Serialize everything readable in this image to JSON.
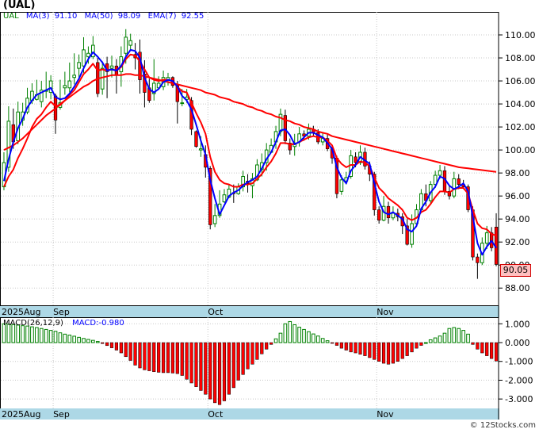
{
  "title": "(UAL)",
  "legend": {
    "ticker": "UAL",
    "ma3_label": "MA(3)",
    "ma3_value": "91.10",
    "ma50_label": "MA(50)",
    "ma50_value": "98.09",
    "ema7_label": "EMA(7)",
    "ema7_value": "92.55"
  },
  "macd_legend": {
    "label": "MACD(26,12,9)",
    "value_label": "MACD:-0.980"
  },
  "watermark": "© 12Stocks.com",
  "last_price_label": "90.05",
  "colors": {
    "up": "#008000",
    "down": "#ff0000",
    "ma_blue": "#0000ff",
    "ema_red": "#ff0000",
    "axis_band": "#add8e6"
  },
  "chart_data": [
    {
      "type": "candlestick",
      "ylim": [
        86.5,
        112
      ],
      "y_ticks": [
        "88.00",
        "90.00",
        "92.00",
        "94.00",
        "96.00",
        "98.00",
        "100.00",
        "102.00",
        "104.00",
        "106.00",
        "108.00",
        "110.00"
      ],
      "x_labels": [
        {
          "text": "2025Aug",
          "index": 0
        },
        {
          "text": "Sep",
          "index": 11
        },
        {
          "text": "Oct",
          "index": 44
        },
        {
          "text": "Nov",
          "index": 80
        }
      ],
      "candles": [
        [
          96.8,
          98.9,
          96.5,
          99.8
        ],
        [
          98.5,
          102.5,
          98.1,
          103.8
        ],
        [
          102.2,
          100.7,
          100.1,
          103.6
        ],
        [
          100.8,
          103.3,
          100.5,
          104.2
        ],
        [
          102.6,
          103.3,
          102.1,
          104.1
        ],
        [
          103.3,
          104.5,
          103.1,
          105.4
        ],
        [
          104.3,
          105.1,
          104.0,
          105.8
        ],
        [
          104.4,
          104.8,
          104.3,
          106.1
        ],
        [
          104.2,
          105.2,
          103.7,
          106.0
        ],
        [
          105.1,
          105.2,
          104.5,
          106.8
        ],
        [
          105.0,
          106.0,
          104.4,
          106.5
        ],
        [
          104.7,
          102.6,
          101.4,
          104.9
        ],
        [
          103.7,
          104.1,
          103.5,
          106.1
        ],
        [
          105.4,
          105.6,
          104.8,
          106.8
        ],
        [
          105.4,
          106.0,
          105.0,
          107.6
        ],
        [
          106.3,
          106.5,
          105.7,
          108.4
        ],
        [
          107.1,
          107.6,
          106.3,
          108.3
        ],
        [
          107.3,
          108.7,
          106.7,
          109.8
        ],
        [
          108.1,
          108.4,
          107.5,
          109.0
        ],
        [
          108.1,
          109.1,
          107.9,
          109.9
        ],
        [
          107.6,
          104.9,
          104.6,
          108.0
        ],
        [
          105.3,
          107.1,
          104.8,
          107.7
        ],
        [
          107.5,
          106.8,
          104.5,
          108.1
        ],
        [
          107.1,
          107.3,
          106.3,
          108.2
        ],
        [
          107.3,
          106.5,
          104.9,
          107.9
        ],
        [
          106.8,
          108.1,
          105.5,
          109.0
        ],
        [
          108.4,
          109.8,
          107.5,
          110.5
        ],
        [
          109.1,
          109.5,
          108.6,
          110.1
        ],
        [
          108.3,
          108.0,
          107.0,
          109.3
        ],
        [
          108.5,
          106.1,
          104.9,
          109.6
        ],
        [
          106.6,
          105.0,
          103.7,
          107.8
        ],
        [
          105.4,
          104.3,
          104.1,
          106.2
        ],
        [
          104.9,
          105.8,
          104.3,
          107.9
        ],
        [
          105.4,
          105.8,
          105.3,
          106.4
        ],
        [
          105.5,
          106.3,
          105.2,
          106.9
        ],
        [
          106.1,
          106.3,
          105.6,
          106.7
        ],
        [
          106.3,
          105.6,
          105.4,
          106.4
        ],
        [
          105.6,
          104.2,
          102.3,
          106.0
        ],
        [
          104.1,
          104.1,
          103.8,
          105.3
        ],
        [
          104.4,
          104.6,
          104.1,
          105.3
        ],
        [
          104.3,
          101.8,
          101.3,
          104.6
        ],
        [
          101.6,
          100.3,
          100.2,
          101.7
        ],
        [
          100.0,
          100.1,
          99.4,
          101.2
        ],
        [
          99.6,
          98.5,
          97.6,
          100.4
        ],
        [
          98.4,
          93.5,
          93.1,
          98.6
        ],
        [
          93.6,
          94.3,
          93.3,
          95.3
        ],
        [
          94.3,
          95.3,
          94.1,
          96.5
        ],
        [
          95.5,
          96.1,
          95.4,
          96.6
        ],
        [
          95.9,
          96.6,
          95.8,
          97.0
        ],
        [
          96.3,
          96.2,
          95.4,
          97.0
        ],
        [
          96.2,
          96.8,
          96.1,
          97.1
        ],
        [
          96.8,
          97.7,
          96.4,
          98.2
        ],
        [
          97.3,
          97.1,
          96.3,
          97.9
        ],
        [
          96.9,
          97.5,
          95.8,
          98.0
        ],
        [
          97.4,
          98.7,
          97.3,
          99.2
        ],
        [
          98.3,
          98.9,
          97.7,
          99.7
        ],
        [
          98.9,
          100.0,
          98.2,
          100.6
        ],
        [
          99.8,
          100.4,
          99.8,
          101.0
        ],
        [
          100.7,
          101.6,
          100.1,
          102.1
        ],
        [
          101.6,
          103.1,
          101.2,
          103.6
        ],
        [
          103.0,
          100.8,
          100.5,
          103.5
        ],
        [
          100.6,
          100.0,
          99.6,
          101.0
        ],
        [
          100.3,
          100.6,
          99.5,
          101.4
        ],
        [
          100.7,
          101.4,
          100.3,
          102.0
        ],
        [
          101.4,
          101.2,
          100.8,
          101.7
        ],
        [
          101.2,
          101.8,
          100.9,
          102.3
        ],
        [
          101.8,
          101.5,
          101.2,
          102.1
        ],
        [
          101.5,
          100.7,
          100.5,
          101.8
        ],
        [
          100.7,
          101.0,
          100.4,
          101.5
        ],
        [
          101.0,
          100.1,
          99.9,
          101.4
        ],
        [
          100.1,
          99.3,
          98.8,
          100.3
        ],
        [
          99.3,
          96.2,
          95.8,
          99.5
        ],
        [
          96.4,
          97.4,
          96.1,
          97.8
        ],
        [
          97.3,
          97.6,
          97.0,
          98.1
        ],
        [
          97.7,
          99.5,
          97.5,
          100.0
        ],
        [
          99.4,
          98.9,
          98.5,
          99.8
        ],
        [
          98.9,
          99.8,
          98.7,
          100.4
        ],
        [
          99.8,
          98.6,
          98.3,
          100.2
        ],
        [
          98.6,
          97.9,
          97.3,
          99.0
        ],
        [
          97.9,
          94.8,
          94.3,
          98.1
        ],
        [
          94.8,
          93.9,
          93.6,
          95.1
        ],
        [
          93.9,
          95.1,
          93.8,
          96.0
        ],
        [
          95.1,
          94.1,
          93.6,
          95.5
        ],
        [
          94.1,
          94.5,
          93.9,
          95.1
        ],
        [
          94.5,
          94.2,
          93.8,
          94.9
        ],
        [
          94.2,
          93.4,
          92.7,
          94.5
        ],
        [
          93.4,
          91.8,
          91.7,
          94.0
        ],
        [
          91.8,
          93.6,
          91.5,
          94.4
        ],
        [
          93.6,
          94.8,
          93.3,
          95.3
        ],
        [
          94.8,
          96.2,
          94.7,
          96.6
        ],
        [
          96.2,
          95.6,
          95.1,
          97.0
        ],
        [
          95.6,
          97.0,
          95.3,
          97.3
        ],
        [
          97.0,
          97.8,
          96.7,
          98.2
        ],
        [
          97.8,
          98.2,
          97.5,
          98.7
        ],
        [
          98.2,
          96.4,
          96.1,
          98.6
        ],
        [
          96.4,
          96.0,
          95.7,
          96.9
        ],
        [
          96.0,
          97.5,
          95.8,
          98.1
        ],
        [
          97.5,
          97.0,
          96.6,
          97.9
        ],
        [
          97.0,
          96.8,
          96.6,
          97.4
        ],
        [
          96.8,
          94.8,
          94.6,
          97.0
        ],
        [
          94.8,
          90.7,
          90.4,
          95.1
        ],
        [
          90.7,
          90.2,
          88.8,
          91.0
        ],
        [
          90.2,
          91.9,
          90.0,
          92.4
        ],
        [
          91.9,
          92.8,
          91.4,
          93.4
        ],
        [
          92.8,
          91.5,
          91.2,
          93.3
        ],
        [
          93.3,
          90.05,
          89.9,
          94.5
        ]
      ],
      "ma3": [
        97.3,
        99.2,
        100.7,
        101.9,
        102.7,
        103.7,
        104.3,
        104.8,
        105.0,
        105.2,
        105.4,
        104.6,
        104.4,
        104.5,
        104.9,
        105.5,
        106.2,
        107.1,
        107.9,
        108.5,
        108.1,
        107.6,
        106.9,
        107.0,
        106.9,
        107.3,
        108.1,
        108.7,
        108.6,
        108.0,
        106.3,
        105.3,
        105.0,
        105.3,
        105.9,
        106.1,
        106.0,
        105.5,
        104.7,
        104.3,
        103.5,
        102.2,
        100.8,
        99.6,
        97.4,
        95.8,
        94.4,
        95.2,
        96.0,
        96.3,
        96.5,
        96.9,
        97.2,
        97.4,
        97.7,
        98.4,
        99.2,
        99.8,
        100.7,
        101.7,
        101.8,
        101.3,
        100.5,
        100.7,
        101.1,
        101.5,
        101.5,
        101.3,
        101.1,
        100.6,
        100.1,
        98.5,
        97.6,
        97.1,
        98.2,
        98.7,
        99.4,
        99.1,
        98.8,
        97.1,
        95.5,
        94.6,
        94.4,
        94.6,
        94.3,
        94.0,
        93.1,
        92.9,
        93.4,
        94.9,
        95.5,
        96.3,
        96.8,
        97.7,
        97.5,
        96.9,
        96.6,
        96.8,
        97.1,
        96.4,
        94.2,
        91.9,
        90.9,
        91.6,
        92.1,
        91.5
      ],
      "ema7": [
        96.8,
        97.7,
        98.3,
        99.3,
        100.1,
        101.0,
        102.0,
        102.7,
        103.1,
        103.7,
        104.2,
        103.8,
        103.9,
        104.3,
        104.8,
        105.2,
        105.9,
        106.6,
        107.0,
        107.5,
        106.9,
        107.0,
        106.9,
        107.0,
        106.9,
        107.2,
        107.9,
        108.3,
        108.2,
        107.7,
        107.0,
        106.3,
        106.1,
        106.0,
        106.1,
        106.1,
        106.0,
        105.5,
        105.1,
        105.0,
        104.1,
        103.2,
        102.4,
        101.4,
        99.4,
        98.1,
        97.4,
        97.1,
        97.0,
        96.8,
        96.8,
        97.0,
        97.0,
        97.1,
        97.5,
        97.9,
        98.5,
        99.0,
        99.7,
        100.6,
        100.6,
        100.5,
        100.5,
        100.7,
        100.9,
        101.1,
        101.2,
        101.1,
        101.1,
        100.8,
        100.4,
        99.3,
        98.8,
        98.5,
        98.7,
        98.7,
        99.0,
        98.9,
        98.6,
        97.6,
        96.7,
        96.3,
        95.8,
        95.5,
        95.2,
        94.8,
        94.1,
        93.9,
        94.1,
        94.6,
        94.8,
        95.3,
        95.9,
        96.4,
        96.4,
        96.3,
        96.6,
        96.7,
        96.7,
        96.2,
        94.8,
        93.6,
        93.2,
        93.1,
        92.7,
        92.55
      ],
      "ma50": [
        100.0,
        100.2,
        100.4,
        100.7,
        101.0,
        101.4,
        101.8,
        102.2,
        102.6,
        103.0,
        103.3,
        103.6,
        104.0,
        104.3,
        104.6,
        104.9,
        105.2,
        105.5,
        105.7,
        106.0,
        106.2,
        106.3,
        106.4,
        106.5,
        106.5,
        106.5,
        106.6,
        106.6,
        106.5,
        106.5,
        106.4,
        106.3,
        106.2,
        106.1,
        106.0,
        105.9,
        105.8,
        105.7,
        105.6,
        105.5,
        105.4,
        105.3,
        105.2,
        105.0,
        104.9,
        104.8,
        104.6,
        104.5,
        104.4,
        104.2,
        104.1,
        104.0,
        103.8,
        103.7,
        103.5,
        103.4,
        103.2,
        103.1,
        102.9,
        102.8,
        102.6,
        102.5,
        102.3,
        102.2,
        102.0,
        101.9,
        101.8,
        101.6,
        101.5,
        101.4,
        101.2,
        101.1,
        101.0,
        100.9,
        100.8,
        100.7,
        100.6,
        100.5,
        100.4,
        100.3,
        100.2,
        100.1,
        100.0,
        99.9,
        99.8,
        99.7,
        99.6,
        99.5,
        99.4,
        99.3,
        99.2,
        99.1,
        99.0,
        98.9,
        98.8,
        98.7,
        98.6,
        98.5,
        98.45,
        98.4,
        98.35,
        98.3,
        98.25,
        98.2,
        98.15,
        98.09
      ]
    },
    {
      "type": "bar",
      "name": "MACD(26,12,9)",
      "ylim": [
        -3.5,
        1.35
      ],
      "y_ticks": [
        "1.000",
        "0.000",
        "-1.000",
        "-2.000",
        "-3.000"
      ],
      "tick_values": [
        1,
        0,
        -1,
        -2,
        -3
      ],
      "values": [
        1.0,
        0.98,
        0.95,
        0.93,
        0.9,
        0.88,
        0.84,
        0.8,
        0.75,
        0.7,
        0.65,
        0.6,
        0.52,
        0.45,
        0.4,
        0.34,
        0.28,
        0.22,
        0.17,
        0.12,
        0.06,
        -0.05,
        -0.16,
        -0.28,
        -0.4,
        -0.55,
        -0.75,
        -0.95,
        -1.2,
        -1.35,
        -1.45,
        -1.5,
        -1.55,
        -1.58,
        -1.6,
        -1.6,
        -1.62,
        -1.65,
        -1.75,
        -1.95,
        -2.15,
        -2.35,
        -2.55,
        -2.75,
        -3.0,
        -3.2,
        -3.3,
        -3.1,
        -2.75,
        -2.4,
        -2.0,
        -1.7,
        -1.4,
        -1.15,
        -0.9,
        -0.6,
        -0.35,
        -0.1,
        0.2,
        0.5,
        1.0,
        1.12,
        0.95,
        0.82,
        0.7,
        0.58,
        0.46,
        0.35,
        0.22,
        0.1,
        -0.02,
        -0.15,
        -0.3,
        -0.4,
        -0.5,
        -0.55,
        -0.62,
        -0.7,
        -0.8,
        -0.9,
        -1.0,
        -1.1,
        -1.15,
        -1.1,
        -1.0,
        -0.85,
        -0.7,
        -0.5,
        -0.3,
        -0.15,
        0.0,
        0.15,
        0.25,
        0.35,
        0.5,
        0.75,
        0.8,
        0.75,
        0.65,
        0.45,
        -0.1,
        -0.35,
        -0.55,
        -0.7,
        -0.85,
        -0.98
      ]
    }
  ]
}
